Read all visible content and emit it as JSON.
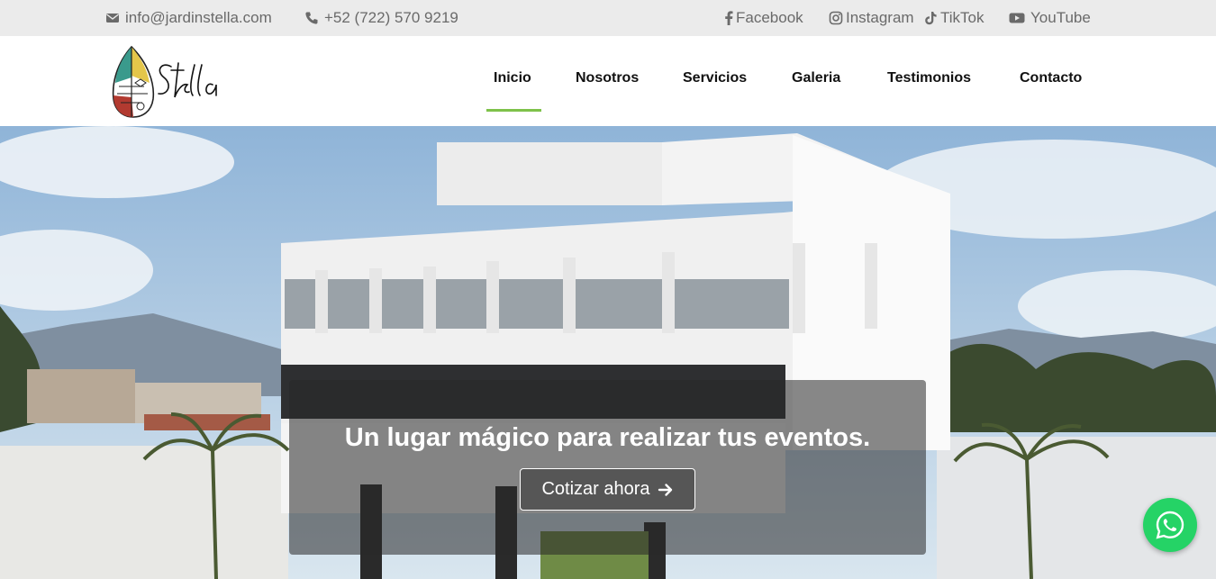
{
  "topbar": {
    "email": "info@jardinstella.com",
    "phone": "+52 (722) 570 9219",
    "social": {
      "facebook": "Facebook",
      "instagram": "Instagram",
      "tiktok": "TikTok",
      "youtube": "YouTube"
    }
  },
  "brand": {
    "name": "Stella"
  },
  "nav": {
    "items": [
      "Inicio",
      "Nosotros",
      "Servicios",
      "Galeria",
      "Testimonios",
      "Contacto"
    ],
    "active": "Inicio"
  },
  "hero": {
    "headline": "Un lugar mágico para realizar tus eventos.",
    "cta_label": "Cotizar ahora"
  },
  "icons": {
    "email": "envelope-icon",
    "phone": "phone-icon",
    "facebook": "facebook-icon",
    "instagram": "instagram-icon",
    "tiktok": "tiktok-icon",
    "youtube": "youtube-icon",
    "cta_arrow": "arrow-right-icon",
    "whatsapp": "whatsapp-icon"
  },
  "colors": {
    "accent": "#7ec24a",
    "whatsapp": "#25d366",
    "topbar_bg": "#ebebeb"
  }
}
